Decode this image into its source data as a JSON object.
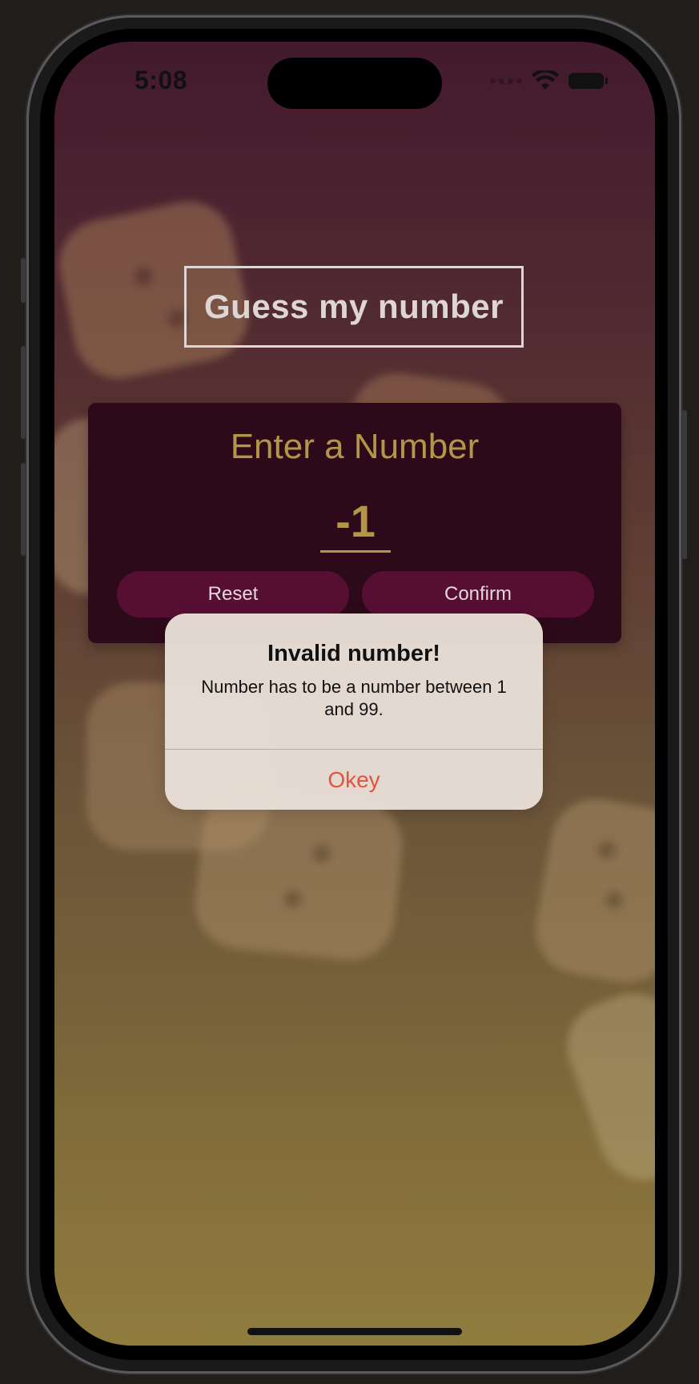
{
  "status_bar": {
    "time": "5:08",
    "icons": [
      "signal-dots-icon",
      "wifi-icon",
      "battery-icon"
    ]
  },
  "app": {
    "title": "Guess my number"
  },
  "input_card": {
    "heading": "Enter a Number",
    "number_value": "-1",
    "reset_label": "Reset",
    "confirm_label": "Confirm"
  },
  "alert": {
    "title": "Invalid number!",
    "message": "Number has to be a number between 1 and 99.",
    "button_label": "Okey"
  },
  "colors": {
    "accent_gold": "#b39747",
    "card_bg": "#2d0a19",
    "button_bg": "#560f33",
    "alert_action": "#e5533f"
  }
}
